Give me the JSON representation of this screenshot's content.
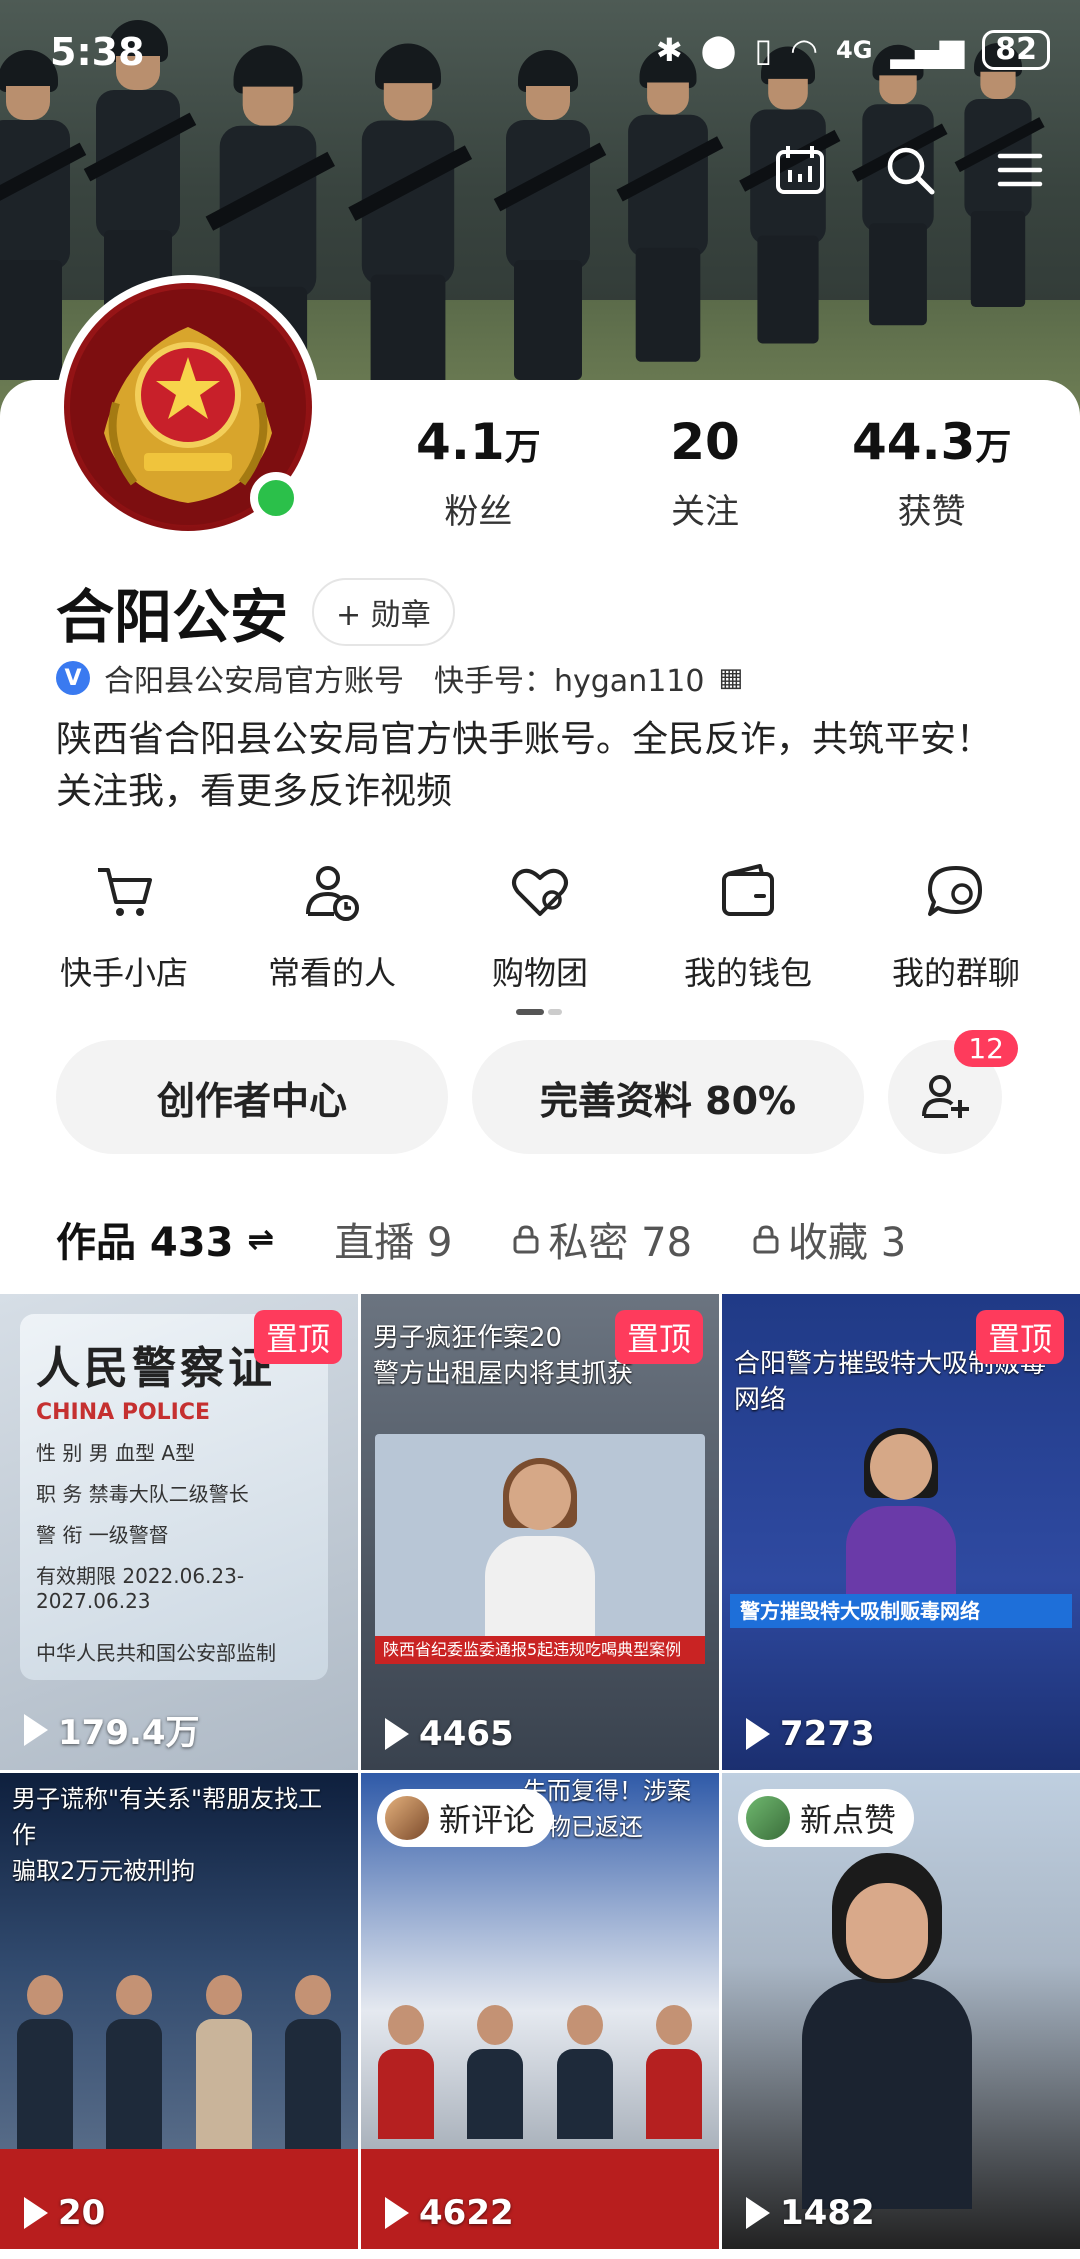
{
  "status": {
    "time": "5:38",
    "network": "4G",
    "battery": "82"
  },
  "profile": {
    "name": "合阳公安",
    "badge_button": "+ 勋章",
    "verify_text": "合阳县公安局官方账号",
    "kuaishou_id": "快手号：hygan110",
    "bio": "陕西省合阳县公安局官方快手账号。全民反诈，共筑平安！关注我，看更多反诈视频",
    "stats": [
      {
        "value": "4.1",
        "unit": "万",
        "label": "粉丝"
      },
      {
        "value": "20",
        "unit": "",
        "label": "关注"
      },
      {
        "value": "44.3",
        "unit": "万",
        "label": "获赞"
      }
    ]
  },
  "shortcuts": [
    {
      "label": "快手小店",
      "icon": "cart-icon"
    },
    {
      "label": "常看的人",
      "icon": "person-clock-icon"
    },
    {
      "label": "购物团",
      "icon": "heart-icon"
    },
    {
      "label": "我的钱包",
      "icon": "wallet-icon"
    },
    {
      "label": "我的群聊",
      "icon": "chat-icon"
    }
  ],
  "actions": {
    "creator": "创作者中心",
    "complete_profile": "完善资料 80%",
    "friend_count": "12"
  },
  "tabs": [
    {
      "label": "作品 433",
      "active": true
    },
    {
      "label": "直播 9",
      "active": false
    },
    {
      "label": "私密 78",
      "active": false,
      "locked": true
    },
    {
      "label": "收藏 3",
      "active": false,
      "locked": true
    }
  ],
  "videos": [
    {
      "views": "179.4万",
      "tag": "置顶"
    },
    {
      "views": "4465",
      "tag": "置顶",
      "title": "男子疯狂作案20\n警方出租屋内将其抓获"
    },
    {
      "views": "7273",
      "tag": "置顶",
      "title": "合阳警方摧毁特大吸制贩毒网络"
    },
    {
      "views": "20",
      "title": "男子谎称\"有关系\"帮朋友找工作\n骗取2万元被刑拘"
    },
    {
      "views": "4622",
      "chip": "新评论",
      "title": "失而复得！涉案财物已返还"
    },
    {
      "views": "1482",
      "chip": "新点赞"
    }
  ],
  "id_card": {
    "title": "人民警察证",
    "english": "CHINA POLICE",
    "sex": "性 别  男     血型  A型",
    "duty": "职 务  禁毒大队二级警长",
    "rank": "警 衔  一级警督",
    "validity": "有效期限  2022.06.23-2027.06.23",
    "issuer": "中华人民共和国公安部监制"
  },
  "news": {
    "sxgc_ticker": "陕西省纪委监委通报5起违规吃喝典型案例",
    "cctv_ticker": "警方摧毁特大吸制贩毒网络"
  }
}
